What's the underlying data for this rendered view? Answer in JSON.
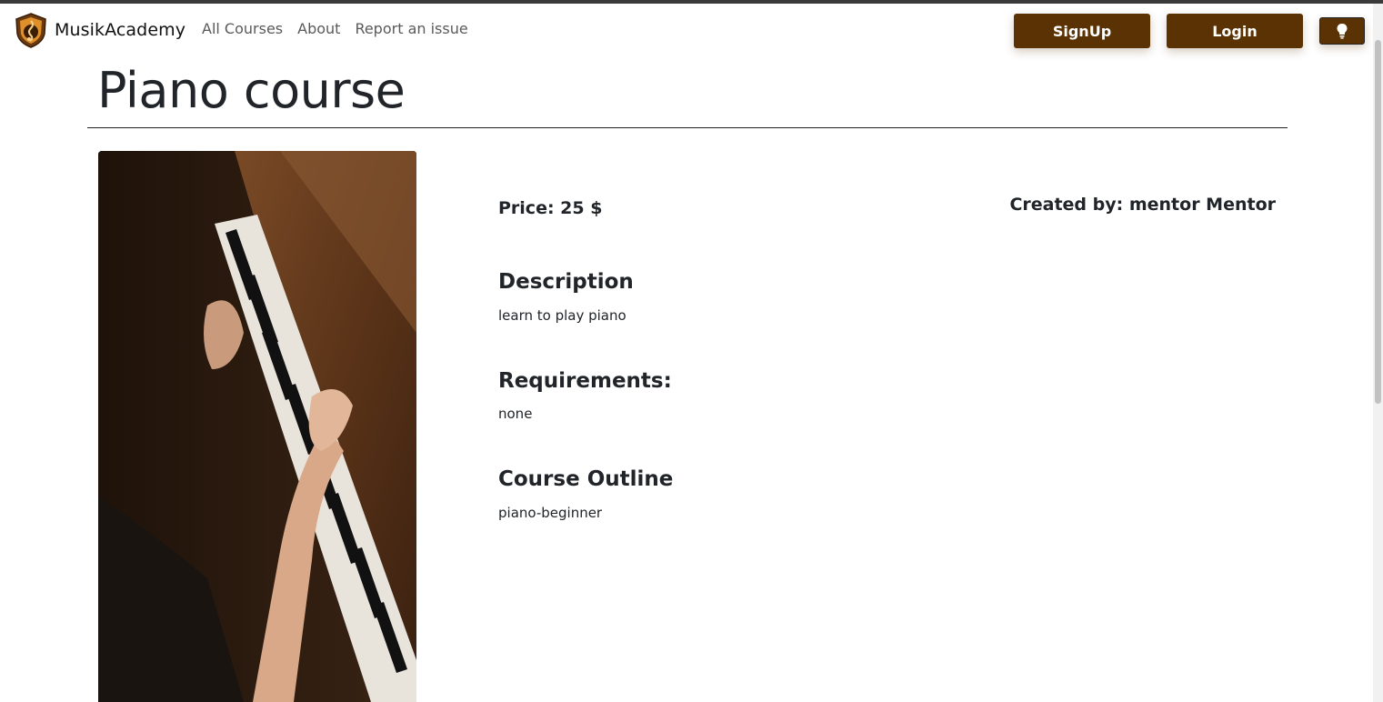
{
  "brand": {
    "name": "MusikAcademy",
    "logo_icon": "music-academy-logo-icon"
  },
  "nav": {
    "links": [
      {
        "label": "All Courses"
      },
      {
        "label": "About"
      },
      {
        "label": "Report an issue"
      }
    ],
    "signup_label": "SignUp",
    "login_label": "Login",
    "theme_icon": "lightbulb-icon"
  },
  "colors": {
    "accent": "#5a3204",
    "text": "#212529",
    "nav_link": "#5a5a5a"
  },
  "course": {
    "title": "Piano course",
    "price_label": "Price: 25 $",
    "created_by_label": "Created by: mentor Mentor",
    "description_heading": "Description",
    "description_text": "learn to play piano",
    "requirements_heading": "Requirements:",
    "requirements_text": "none",
    "outline_heading": "Course Outline",
    "outline_text": "piano-beginner"
  }
}
